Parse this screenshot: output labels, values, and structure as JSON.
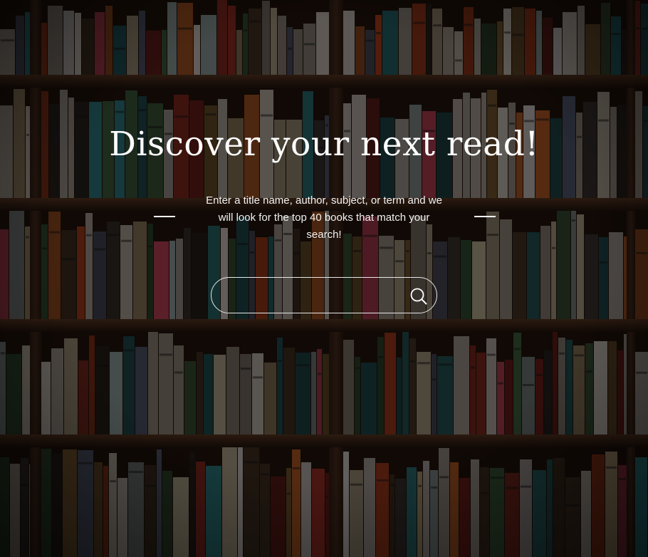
{
  "hero": {
    "title": "Discover your next read!",
    "subtitle": "Enter a title name, author, subject, or term and we will look for the top 40 books that match your search!"
  },
  "search": {
    "value": "",
    "icon": "search-icon"
  },
  "colors": {
    "text": "#ffffff",
    "overlay": "#000000",
    "wood": "#3a2418"
  }
}
